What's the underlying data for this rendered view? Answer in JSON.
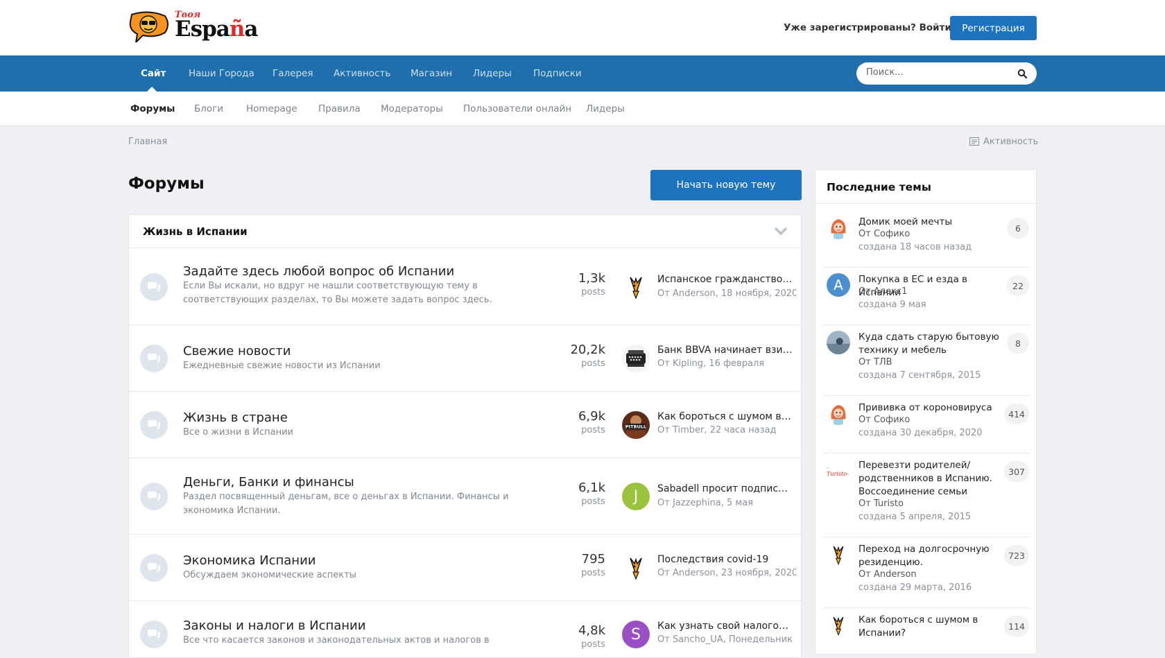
{
  "header": {
    "logo_top": "Твоя",
    "logo_main_a": "Espa",
    "logo_main_enye": "ñ",
    "logo_main_b": "a",
    "signin_label": "Уже зарегистрированы? Войти",
    "register_label": "Регистрация"
  },
  "nav": {
    "items": [
      "Сайт",
      "Наши Города",
      "Галерея",
      "Активность",
      "Магазин",
      "Лидеры",
      "Подписки"
    ],
    "active_index": 0,
    "search_placeholder": "Поиск..."
  },
  "subnav": {
    "items": [
      "Форумы",
      "Блоги",
      "Homepage",
      "Правила",
      "Модераторы",
      "Пользователи онлайн",
      "Лидеры"
    ],
    "active_index": 0
  },
  "breadcrumb": {
    "home": "Главная",
    "activity": "Активность"
  },
  "page": {
    "title": "Форумы",
    "new_topic_label": "Начать новую тему"
  },
  "category": {
    "title": "Жизнь в Испании",
    "forums": [
      {
        "name": "Задайте здесь любой вопрос об Испании",
        "description": "Если Вы искали, но вдруг не нашли соответствующую тему в соответствующих разделах, то Вы можете задать вопрос здесь.",
        "count": "1,3k",
        "count_label": "posts",
        "last_title": "Испанское гражданство - ...",
        "last_meta": "От Anderson, 18 ноября, 2020",
        "avatar": "fox"
      },
      {
        "name": "Свежие новости",
        "description": "Ежедневные свежие новости из Испании",
        "count": "20,2k",
        "count_label": "posts",
        "last_title": "Банк BBVA начинает взима...",
        "last_meta": "От Kipling, 16 февраля",
        "avatar": "typewriter"
      },
      {
        "name": "Жизнь в стране",
        "description": "Все о жизни в Испании",
        "count": "6,9k",
        "count_label": "posts",
        "last_title": "Как бороться с шумом в И...",
        "last_meta": "От Timber, 22 часа назад",
        "avatar": "pitbull"
      },
      {
        "name": "Деньги, Банки и финансы",
        "description": "Раздел посвященный деньгам, все о деньгах в Испании. Финансы и экономика Испании.",
        "count": "6,1k",
        "count_label": "posts",
        "last_title": "Sabadell просит подписать...",
        "last_meta": "От Jazzephina, 5 мая",
        "avatar": "J"
      },
      {
        "name": "Экономика Испании",
        "description": "Обсуждаем экономические аспекты",
        "count": "795",
        "count_label": "posts",
        "last_title": "Последствия covid-19",
        "last_meta": "От Anderson, 23 ноября, 2020",
        "avatar": "fox"
      },
      {
        "name": "Законы и налоги в Испании",
        "description": "Все что касается законов и законодательных актов и налогов в",
        "count": "4,8k",
        "count_label": "posts",
        "last_title": "Как узнать свой налоговы...",
        "last_meta": "От Sancho_UA, Понедельник",
        "avatar": "S"
      }
    ]
  },
  "sidebar": {
    "title": "Последние темы",
    "topics": [
      {
        "title": "Домик моей мечты",
        "by": "От Софико",
        "date": "создана 18 часов назад",
        "count": "6",
        "avatar": "sofiko"
      },
      {
        "title": "Покупка в ЕС и езда в Испании",
        "by": "От Алекс1",
        "date": "создана 9 мая",
        "count": "22",
        "avatar": "A"
      },
      {
        "title": "Куда сдать старую бытовую технику и мебель",
        "by": "От ТЛВ",
        "date": "создана 7 сентября, 2015",
        "count": "8",
        "avatar": "photo"
      },
      {
        "title": "Прививка от короновируса",
        "by": "От Софико",
        "date": "создана 30 декабря, 2020",
        "count": "414",
        "avatar": "sofiko"
      },
      {
        "title": "Перевезти родителей/ родственников в Испанию. Воссоединение семьи",
        "by": "От Turisto",
        "date": "создана 5 апреля, 2015",
        "count": "307",
        "avatar": "turisto",
        "avatar_text": "-Turisto-"
      },
      {
        "title": "Переход на долгосрочную резиденцию.",
        "by": "От Anderson",
        "date": "создана 29 марта, 2016",
        "count": "723",
        "avatar": "fox"
      },
      {
        "title": "Как бороться с шумом в Испании?",
        "by": "",
        "date": "",
        "count": "114",
        "avatar": "fox"
      }
    ]
  },
  "colors": {
    "brand_blue": "#1e73be",
    "nav_blue": "#1e6fac",
    "logo_red": "#e02b2b",
    "avatar_j": "#9bc23c",
    "avatar_s": "#9b4fc4",
    "avatar_a": "#4a8fd0"
  }
}
